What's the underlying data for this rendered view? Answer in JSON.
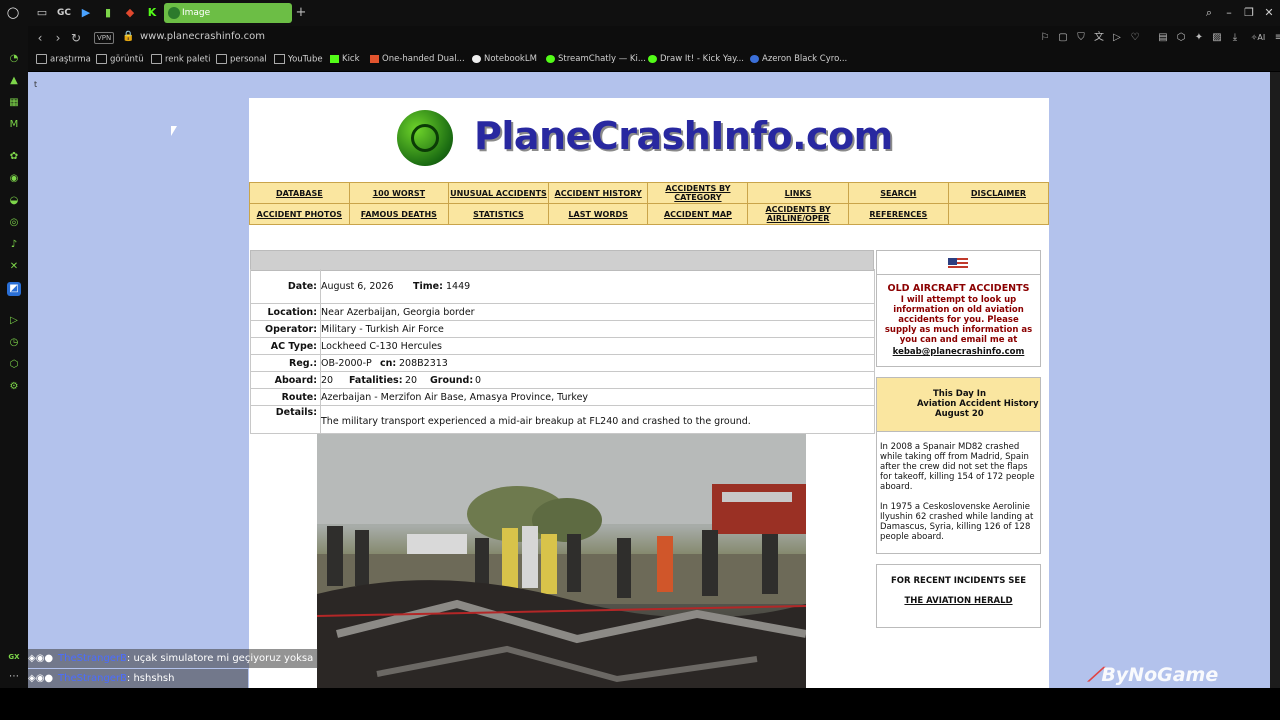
{
  "browser": {
    "tab_title": "Image",
    "url": "www.planecrashinfo.com",
    "vpn_label": "VPN",
    "tb_gc": "GC",
    "bookmarks": [
      "araştırma",
      "görüntü",
      "renk paleti",
      "personal",
      "YouTube",
      "Kick",
      "One-handed Dual...",
      "NotebookLM",
      "StreamChatly — Ki...",
      "Draw It! - Kick Yay...",
      "Azeron Black Cyro..."
    ]
  },
  "page": {
    "stray_text": "t",
    "site_name": "PlaneCrashInfo.com",
    "nav": {
      "row1": [
        "DATABASE",
        "100 WORST",
        "UNUSUAL ACCIDENTS",
        "ACCIDENT HISTORY",
        "ACCIDENTS BY CATEGORY",
        "LINKS",
        "SEARCH",
        "DISCLAIMER"
      ],
      "row2": [
        "ACCIDENT PHOTOS",
        "FAMOUS DEATHS",
        "STATISTICS",
        "LAST WORDS",
        "ACCIDENT MAP",
        "ACCIDENTS BY AIRLINE/OPER",
        "REFERENCES",
        ""
      ]
    },
    "record": {
      "date_label": "Date:",
      "date": "August 6, 2026",
      "time_label": "Time:",
      "time": "1449",
      "location_label": "Location:",
      "location": "Near Azerbaijan, Georgia border",
      "operator_label": "Operator:",
      "operator": "Military - Turkish Air Force",
      "actype_label": "AC Type:",
      "actype": "Lockheed C-130 Hercules",
      "reg_label": "Reg.:",
      "reg": "OB-2000-P",
      "cn_label": "cn:",
      "cn": "208B2313",
      "aboard_label": "Aboard:",
      "aboard": "20",
      "fatal_label": "Fatalities:",
      "fatal": "20",
      "ground_label": "Ground:",
      "ground": "0",
      "route_label": "Route:",
      "route": "Azerbaijan - Merzifon Air Base, Amasya Province, Turkey",
      "details_label": "Details:",
      "details": "The military transport experienced a mid-air breakup at FL240 and crashed to the ground."
    },
    "sidebar": {
      "old_title": "OLD AIRCRAFT ACCIDENTS",
      "old_body": "I will attempt to look up information on old aviation accidents for you. Please supply as much information as you can and email me at",
      "email": "kebab@planecrashinfo.com",
      "today_l1": "This Day In",
      "today_l2": "Aviation Accident History",
      "today_l3": "August 20",
      "today_p1": "In 2008 a Spanair MD82 crashed while taking off from Madrid, Spain after the crew did not set the flaps for takeoff, killing 154 of 172 people aboard.",
      "today_p2": "In 1975 a Ceskoslovenske Aerolinie Ilyushin 62 crashed while landing at Damascus, Syria, killing 126 of 128 people aboard.",
      "recent_title": "FOR RECENT INCIDENTS SEE",
      "recent_link": "THE AVIATION HERALD"
    }
  },
  "chat": [
    {
      "user": "TheStrangerB",
      "msg": ": uçak simulatore mi geçiyoruz yoksa"
    },
    {
      "user": "TheStrangerB",
      "msg": ": hshshsh"
    }
  ],
  "watermark": "ByNoGame",
  "sidebar_gx": "GX"
}
